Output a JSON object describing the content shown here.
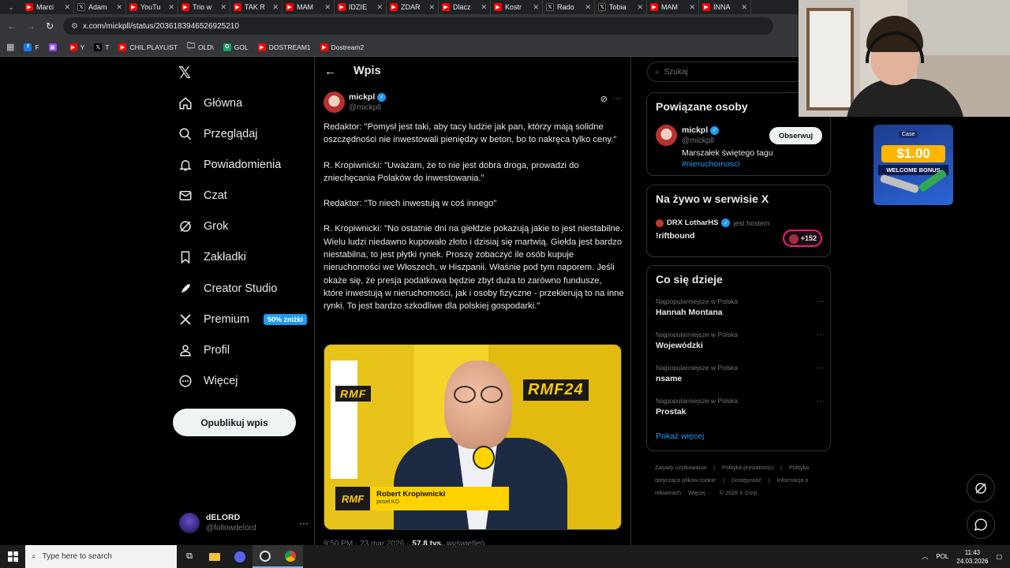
{
  "browser": {
    "tabs": [
      {
        "label": "Marci",
        "icon": "youtube-icon"
      },
      {
        "label": "Adam",
        "icon": "x-icon"
      },
      {
        "label": "YouTu",
        "icon": "youtube-icon"
      },
      {
        "label": "Trio w",
        "icon": "youtube-icon"
      },
      {
        "label": "TAK R",
        "icon": "youtube-icon"
      },
      {
        "label": "MAM",
        "icon": "youtube-icon"
      },
      {
        "label": "IDZIE",
        "icon": "youtube-icon"
      },
      {
        "label": "ZDAR",
        "icon": "youtube-icon"
      },
      {
        "label": "Dlacz",
        "icon": "youtube-icon"
      },
      {
        "label": "Kostr",
        "icon": "youtube-icon"
      },
      {
        "label": "Rado",
        "icon": "x-icon"
      },
      {
        "label": "Tobia",
        "icon": "x-icon"
      },
      {
        "label": "MAM",
        "icon": "youtube-icon"
      },
      {
        "label": "INNA",
        "icon": "youtube-icon"
      }
    ],
    "url": "x.com/mickpll/status/2036183946526925210",
    "bookmarks": [
      {
        "label": "F",
        "icon": "facebook-icon"
      },
      {
        "label": "",
        "icon": "twitch-icon"
      },
      {
        "label": "Y",
        "icon": "youtube-icon"
      },
      {
        "label": "T",
        "icon": "x-icon"
      },
      {
        "label": "CHIL PLAYLIST",
        "icon": "youtube-icon"
      },
      {
        "label": "OLD\\",
        "icon": "folder-icon"
      },
      {
        "label": "GOL",
        "icon": "g-icon"
      },
      {
        "label": "DOSTREAM1",
        "icon": "youtube-icon"
      },
      {
        "label": "Dostream2",
        "icon": "youtube-icon"
      }
    ]
  },
  "nav": {
    "items": [
      {
        "label": "Główna",
        "icon": "home-icon"
      },
      {
        "label": "Przeglądaj",
        "icon": "search-icon"
      },
      {
        "label": "Powiadomienia",
        "icon": "bell-icon"
      },
      {
        "label": "Czat",
        "icon": "mail-icon"
      },
      {
        "label": "Grok",
        "icon": "grok-icon"
      },
      {
        "label": "Zakładki",
        "icon": "bookmark-icon"
      },
      {
        "label": "Creator Studio",
        "icon": "rocket-icon"
      },
      {
        "label": "Premium",
        "icon": "x-icon"
      },
      {
        "label": "Profil",
        "icon": "person-icon"
      },
      {
        "label": "Więcej",
        "icon": "more-circle-icon"
      }
    ],
    "premium_badge": "50% zniżki",
    "post_button": "Opublikuj wpis",
    "account": {
      "display_name": "dELORD",
      "handle": "@followdelord"
    }
  },
  "main": {
    "header_title": "Wpis",
    "post": {
      "author": "mickpl",
      "handle": "@mickpll",
      "paragraphs": [
        "Redaktor: \"Pomysł jest taki, aby tacy ludzie jak pan, którzy mają solidne oszczędności nie inwestowali pieniędzy w beton, bo to nakręca tylko ceny.\"",
        "R. Kropiwnicki: \"Uważam, że to nie jest dobra droga, prowadzi do zniechęcania Polaków do inwestowania.\"",
        "Redaktor: \"To niech inwestują w coś innego\"",
        "R. Kropiwnicki: \"No ostatnie dni na giełdzie pokazują jakie to jest niestabilne. Wielu ludzi niedawno kupowało złoto i dzisiaj się martwią. Giełda jest bardzo niestabilna, to jest płytki rynek. Proszę zobaczyć ile osób kupuje nieruchomości we Włoszech, w Hiszpanii. Właśnie pod tym naporem. Jeśli okaże się, że presja podatkowa będzie zbyt duża to zarówno fundusze,  które inwestują w nieruchomości, jak i osoby fizyczne - przekierują to na inne rynki. To jest bardzo szkodliwe dla polskiej gospodarki.\""
      ],
      "media": {
        "logo": "RMF",
        "logo_badge": "RMF24",
        "lower_third_name": "Robert Kropiwnicki",
        "lower_third_role": "poseł KO"
      },
      "meta_time": "9:50 PM · 23 mar 2026 ·",
      "meta_views": "57,8 tys.",
      "meta_views_label": "wyświetleń"
    }
  },
  "right": {
    "search_placeholder": "Szukaj",
    "related": {
      "title": "Powiązane osoby",
      "name": "mickpl",
      "handle": "@mickpll",
      "bio": "Marszałek świętego tagu",
      "hashtag": "#nieruchomosci",
      "follow_label": "Obserwuj"
    },
    "live": {
      "title": "Na żywo w serwisie X",
      "host": "DRX LotharHS",
      "host_suffix": "jest hostem",
      "space_title": "!riftbound",
      "listeners": "+152"
    },
    "trends": {
      "title": "Co się dzieje",
      "items": [
        {
          "context": "Najpopularniejsze w Polska",
          "name": "Hannah Montana"
        },
        {
          "context": "Najpopularniejsze w Polska",
          "name": "Wojewódzki"
        },
        {
          "context": "Najpopularniejsze w Polska",
          "name": "nsame"
        },
        {
          "context": "Najpopularniejsze w Polska",
          "name": "Prostak"
        }
      ],
      "show_more": "Pokaż więcej"
    },
    "footer": [
      "Zasady użytkowania",
      "|",
      "Polityka prywatności",
      "|",
      "Polityka dotycząca plików cookie",
      "|",
      "Dostępność",
      "|",
      "Informacja o reklamach",
      "Więcej ···",
      "© 2026 X Corp."
    ]
  },
  "ad": {
    "brand": "Case",
    "amount": "$1.00",
    "bonus": "WELCOME BONUS"
  },
  "taskbar": {
    "search_placeholder": "Type here to search",
    "language": "POL",
    "time": "11:43",
    "date": "24.03.2026"
  }
}
